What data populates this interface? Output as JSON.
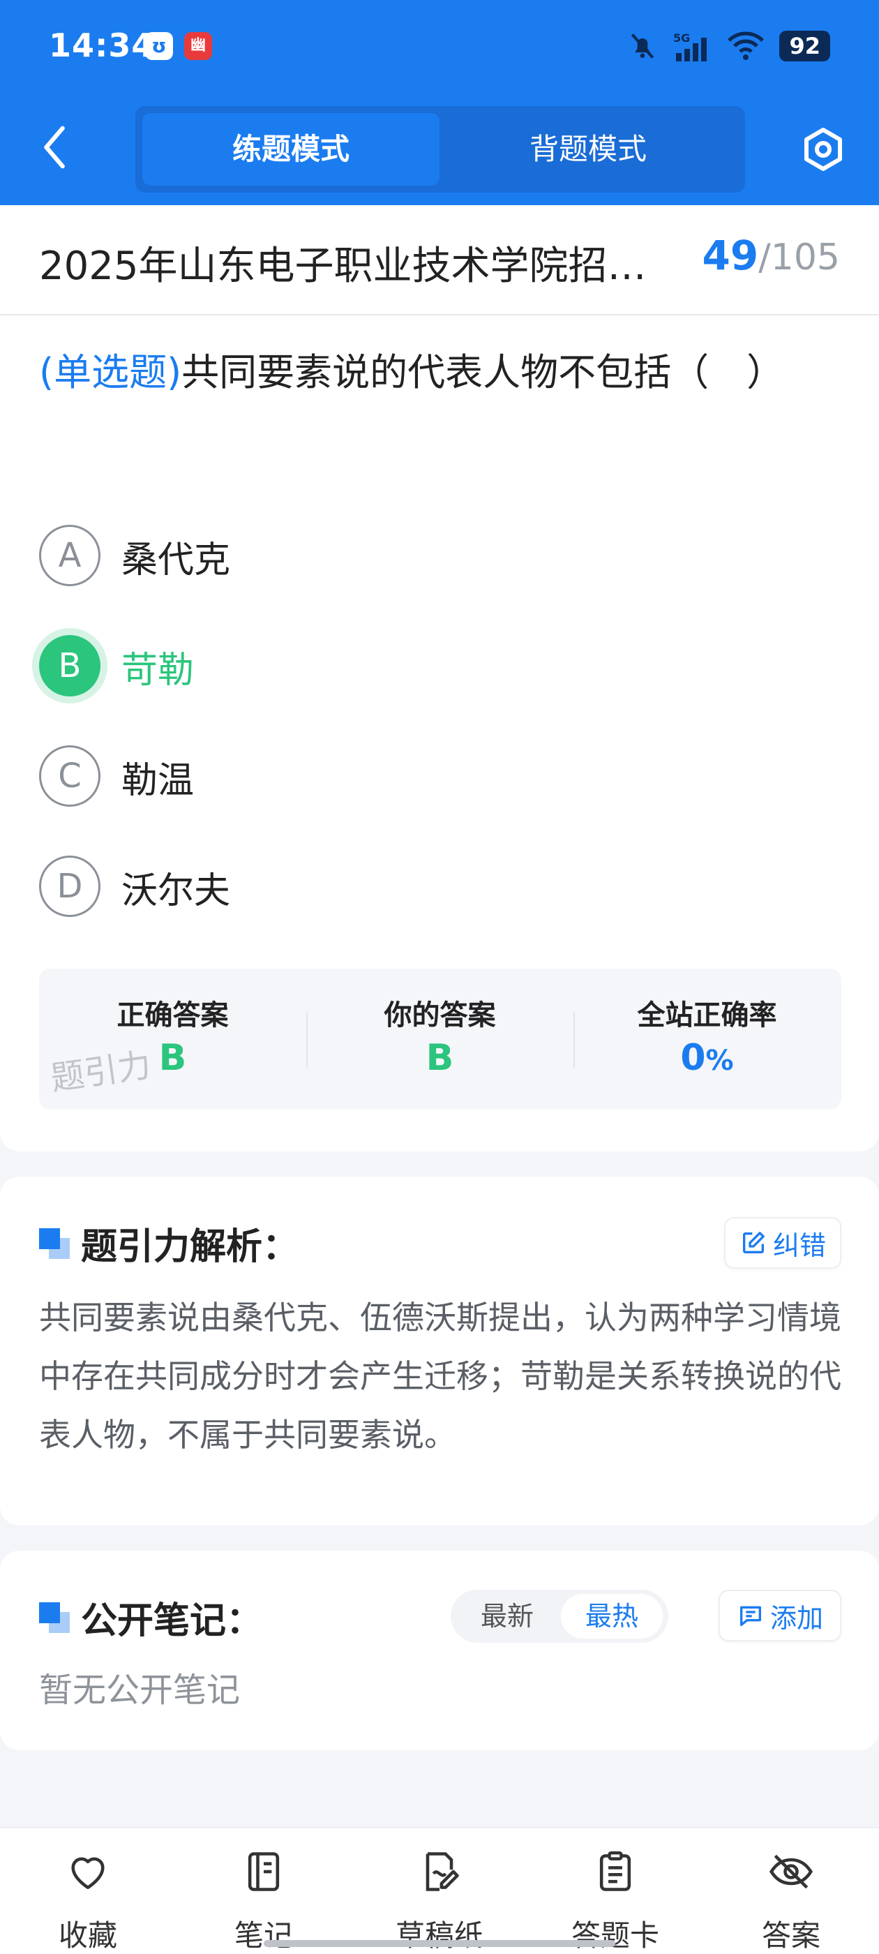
{
  "status_bar": {
    "time": "14:34",
    "badge1": "ʊ",
    "badge2": "幽",
    "network": "5G",
    "battery": "92"
  },
  "header": {
    "modes": [
      "练题模式",
      "背题模式"
    ],
    "active_mode_index": 0
  },
  "exam": {
    "title": "2025年山东电子职业技术学院招…",
    "current": "49",
    "separator": "/",
    "total": "105"
  },
  "question": {
    "type": "(单选题)",
    "text": "共同要素说的代表人物不包括（　）",
    "options": [
      {
        "letter": "A",
        "text": "桑代克"
      },
      {
        "letter": "B",
        "text": "苛勒"
      },
      {
        "letter": "C",
        "text": "勒温"
      },
      {
        "letter": "D",
        "text": "沃尔夫"
      }
    ],
    "selected_index": 1
  },
  "answer_summary": {
    "correct_label": "正确答案",
    "correct_value": "B",
    "yours_label": "你的答案",
    "yours_value": "B",
    "rate_label": "全站正确率",
    "rate_value": "0",
    "rate_unit": "%",
    "watermark": "题引力"
  },
  "analysis": {
    "title": "题引力解析：",
    "correct_button": "纠错",
    "text": "共同要素说由桑代克、伍德沃斯提出，认为两种学习情境中存在共同成分时才会产生迁移；苛勒是关系转换说的代表人物，不属于共同要素说。"
  },
  "notes": {
    "title": "公开笔记：",
    "sort_options": [
      "最新",
      "最热"
    ],
    "active_sort_index": 1,
    "add_button": "添加",
    "empty_text": "暂无公开笔记"
  },
  "bottom_nav": [
    {
      "label": "收藏",
      "icon": "heart-icon"
    },
    {
      "label": "笔记",
      "icon": "notebook-icon"
    },
    {
      "label": "草稿纸",
      "icon": "draft-icon"
    },
    {
      "label": "答题卡",
      "icon": "answer-sheet-icon"
    },
    {
      "label": "答案",
      "icon": "eye-off-icon"
    }
  ],
  "colors": {
    "primary": "#1b7cf0",
    "correct_green": "#2bc57d"
  }
}
